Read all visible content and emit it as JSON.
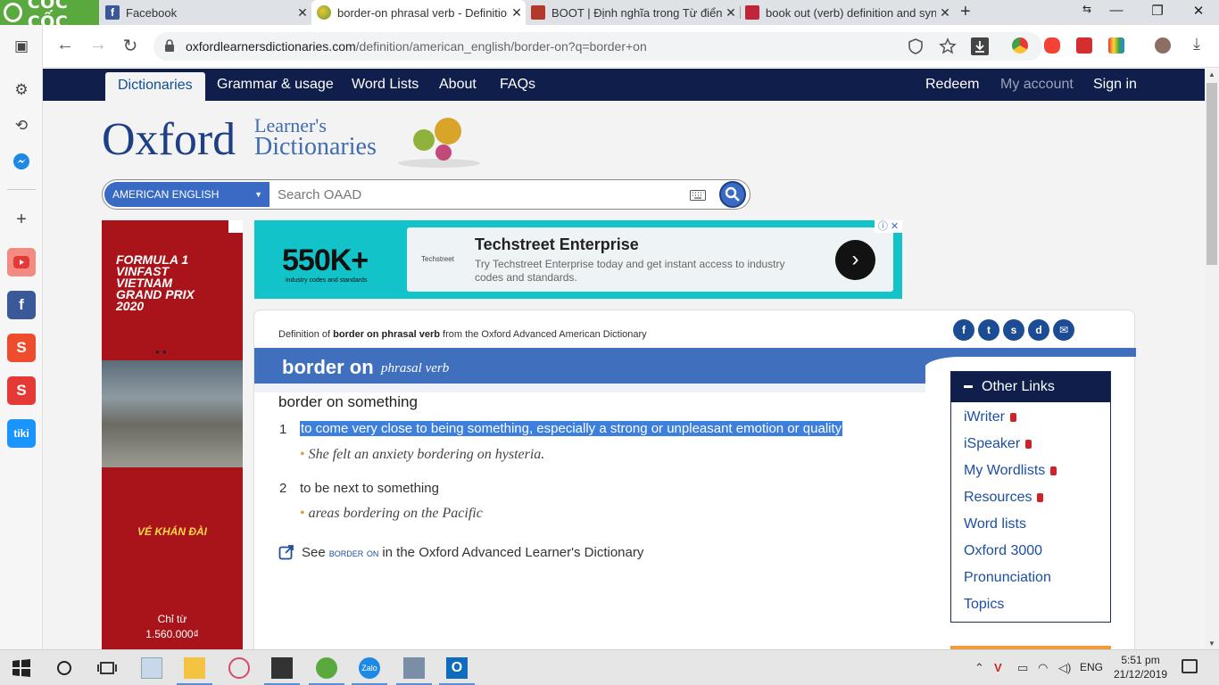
{
  "browser": {
    "brand_name": "CỐC CỐC",
    "tabs": [
      {
        "title": "Facebook",
        "active": false,
        "favicon_color": "#3b5998"
      },
      {
        "title": "border-on phrasal verb - Definition",
        "active": true,
        "favicon_color": "#9bbf3b"
      },
      {
        "title": "BOOT | Định nghĩa trong Từ điển t",
        "active": false,
        "favicon_color": "#b23a2c"
      },
      {
        "title": "book out (verb) definition and syn",
        "active": false,
        "favicon_color": "#c0263a"
      }
    ],
    "url_host": "oxfordlearnersdictionaries.com",
    "url_path": "/definition/american_english/border-on?q=border+on"
  },
  "site": {
    "nav": {
      "dictionaries": "Dictionaries",
      "grammar": "Grammar & usage",
      "word_lists": "Word Lists",
      "about": "About",
      "faqs": "FAQs",
      "redeem": "Redeem",
      "my_account": "My account",
      "sign_in": "Sign in"
    },
    "logo": {
      "oxford": "Oxford",
      "learners": "Learner's",
      "dictionaries": "Dictionaries"
    },
    "search": {
      "dictionary": "AMERICAN ENGLISH",
      "placeholder": "Search OAAD"
    }
  },
  "ads": {
    "left": {
      "headline": "FORMULA 1 VINFAST VIETNAM GRAND PRIX 2020",
      "cta": "VÉ KHÁN ĐÀI",
      "from": "Chỉ từ",
      "price": "1.560.000₫"
    },
    "top": {
      "stat": "550K+",
      "stat_caption": "industry codes and standards",
      "brand": "Techstreet",
      "title": "Techstreet Enterprise",
      "text": "Try Techstreet Enterprise today and get instant access to industry codes and standards."
    }
  },
  "entry": {
    "source_prefix": "Definition of ",
    "source_bold": "border on phrasal verb",
    "source_suffix": " from the Oxford Advanced American Dictionary",
    "headword": "border on",
    "pos": "phrasal verb",
    "sense_group": "border on something",
    "senses": [
      {
        "num": "1",
        "def": "to come very close to being something, especially a strong or unpleasant emotion or quality",
        "example": "She felt an anxiety bordering on hysteria."
      },
      {
        "num": "2",
        "def": "to be next to something",
        "example": "areas bordering on the Pacific"
      }
    ],
    "see_prefix": "See",
    "see_ref": "border on",
    "see_suffix": "in the Oxford Advanced Learner's Dictionary"
  },
  "other_links": {
    "title": "Other Links",
    "items": [
      "iWriter",
      "iSpeaker",
      "My Wordlists",
      "Resources",
      "Word lists",
      "Oxford 3000",
      "Pronunciation",
      "Topics"
    ],
    "locked": [
      true,
      true,
      true,
      true,
      false,
      false,
      false,
      false
    ]
  },
  "taskbar": {
    "lang": "ENG",
    "time": "5:51 pm",
    "date": "21/12/2019"
  }
}
